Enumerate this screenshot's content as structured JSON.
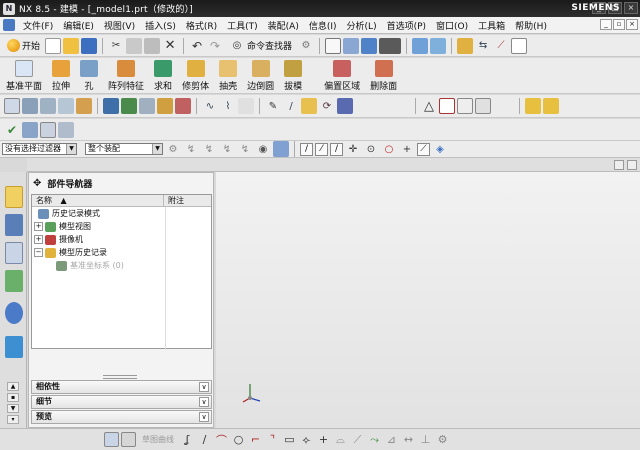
{
  "window": {
    "title": "NX 8.5 - 建模 - [_model1.prt（修改的）]",
    "brand": "SIEMENS",
    "app_icon_glyph": "N"
  },
  "menubar": {
    "items": [
      "文件(F)",
      "编辑(E)",
      "视图(V)",
      "插入(S)",
      "格式(R)",
      "工具(T)",
      "装配(A)",
      "信息(I)",
      "分析(L)",
      "首选项(P)",
      "窗口(O)",
      "工具箱",
      "帮助(H)"
    ]
  },
  "standard_toolbar": {
    "start_label": "开始",
    "finder_label": "命令查找器"
  },
  "feature_toolbar": {
    "items": [
      {
        "label": "基准平面",
        "icon": "datum-plane-icon",
        "color": "#d9e6f6"
      },
      {
        "label": "拉伸",
        "icon": "extrude-icon",
        "color": "#e8a23c"
      },
      {
        "label": "孔",
        "icon": "hole-icon",
        "color": "#7aa0c8"
      },
      {
        "label": "阵列特征",
        "icon": "pattern-feature-icon",
        "color": "#d98c3c"
      },
      {
        "label": "求和",
        "icon": "unite-icon",
        "color": "#3a9a6a"
      },
      {
        "label": "修剪体",
        "icon": "trim-body-icon",
        "color": "#e0b040"
      },
      {
        "label": "抽壳",
        "icon": "shell-icon",
        "color": "#e7c070"
      },
      {
        "label": "边倒圆",
        "icon": "edge-blend-icon",
        "color": "#d8b060"
      },
      {
        "label": "拔模",
        "icon": "draft-icon",
        "color": "#c0a040"
      },
      {
        "label": "偏置区域",
        "icon": "offset-region-icon",
        "color": "#c86060"
      },
      {
        "label": "删除面",
        "icon": "delete-face-icon",
        "color": "#d07050"
      }
    ]
  },
  "selection_bar": {
    "filter_value": "没有选择过滤器",
    "scope_value": "整个装配"
  },
  "part_navigator": {
    "title": "部件导航器",
    "col_name": "名称",
    "col_note": "附注",
    "rows": [
      {
        "label": "历史记录模式",
        "expander": "",
        "icon": "history-mode-icon",
        "color": "#6a8fb8",
        "dim": false,
        "indent": 6
      },
      {
        "label": "模型视图",
        "expander": "+",
        "icon": "model-views-icon",
        "color": "#5aa05a",
        "dim": false,
        "indent": 2
      },
      {
        "label": "摄像机",
        "expander": "+",
        "icon": "camera-icon",
        "color": "#c04040",
        "dim": false,
        "indent": 2
      },
      {
        "label": "模型历史记录",
        "expander": "−",
        "icon": "folder-icon",
        "color": "#e2b33c",
        "dim": false,
        "indent": 2
      },
      {
        "label": "基准坐标系 (0)",
        "expander": "",
        "icon": "datum-csys-icon",
        "color": "#7a9a7a",
        "dim": true,
        "indent": 24
      }
    ],
    "panels": [
      "相依性",
      "细节",
      "预览"
    ]
  },
  "bottom_toolbar": {
    "dim_label": "草图曲线"
  }
}
